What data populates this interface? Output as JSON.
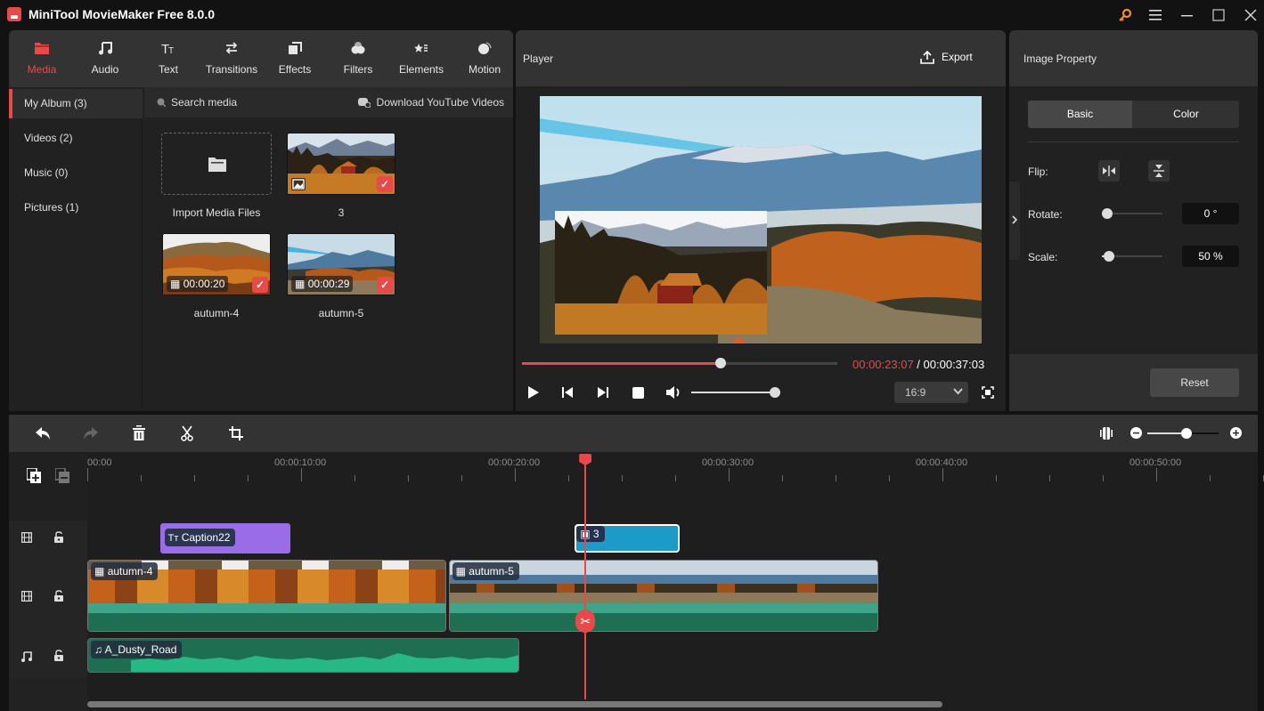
{
  "app": {
    "title": "MiniTool MovieMaker Free 8.0.0",
    "window_controls": [
      "key-icon",
      "menu-icon",
      "minimize-icon",
      "maximize-icon",
      "close-icon"
    ]
  },
  "nav": {
    "items": [
      {
        "label": "Media",
        "icon": "folder-icon",
        "active": true
      },
      {
        "label": "Audio",
        "icon": "music-icon"
      },
      {
        "label": "Text",
        "icon": "text-icon"
      },
      {
        "label": "Transitions",
        "icon": "transitions-icon"
      },
      {
        "label": "Effects",
        "icon": "effects-icon"
      },
      {
        "label": "Filters",
        "icon": "filters-icon"
      },
      {
        "label": "Elements",
        "icon": "elements-icon"
      },
      {
        "label": "Motion",
        "icon": "motion-icon"
      }
    ]
  },
  "album": {
    "items": [
      {
        "label": "My Album (3)",
        "active": true
      },
      {
        "label": "Videos (2)"
      },
      {
        "label": "Music (0)"
      },
      {
        "label": "Pictures (1)"
      }
    ]
  },
  "media": {
    "search_placeholder": "Search media",
    "download_label": "Download YouTube Videos",
    "import_label": "Import Media Files",
    "files": [
      {
        "name": "3",
        "type": "image",
        "selected": true
      },
      {
        "name": "autumn-4",
        "type": "video",
        "duration": "00:00:20",
        "selected": true
      },
      {
        "name": "autumn-5",
        "type": "video",
        "duration": "00:00:29",
        "selected": true
      }
    ]
  },
  "player": {
    "title": "Player",
    "export_label": "Export",
    "current_time": "00:00:23:07",
    "separator": " / ",
    "total_time": "00:00:37:03",
    "progress_fraction": 0.63,
    "volume_fraction": 1.0,
    "aspect_ratio": "16:9"
  },
  "property": {
    "title": "Image Property",
    "tabs": [
      {
        "label": "Basic",
        "active": true
      },
      {
        "label": "Color"
      }
    ],
    "flip_label": "Flip:",
    "rotate_label": "Rotate:",
    "rotate_value": "0 °",
    "rotate_fraction": 0.0,
    "scale_label": "Scale:",
    "scale_value": "50 %",
    "scale_fraction": 0.12,
    "reset_label": "Reset"
  },
  "timeline": {
    "ruler_labels": [
      "00:00",
      "00:00:10:00",
      "00:00:20:00",
      "00:00:30:00",
      "00:00:40:00",
      "00:00:50:00"
    ],
    "playhead_seconds": 23.3,
    "zoom_fraction": 0.55,
    "clips": {
      "caption": {
        "label": "Caption22",
        "start": 3.4,
        "end": 9.5,
        "color": "#9b6ce8"
      },
      "image": {
        "label": "3",
        "start": 22.8,
        "end": 27.7,
        "color": "#1d9ac7"
      },
      "video1": {
        "label": "autumn-4",
        "start": 0,
        "end": 16.8
      },
      "video2": {
        "label": "autumn-5",
        "start": 16.9,
        "end": 37.0
      },
      "audio": {
        "label": "A_Dusty_Road",
        "start": 0,
        "end": 20.2
      }
    }
  },
  "colors": {
    "accent": "#e84a4a",
    "audio_green": "#26b985",
    "video_green": "#1e6e52"
  }
}
